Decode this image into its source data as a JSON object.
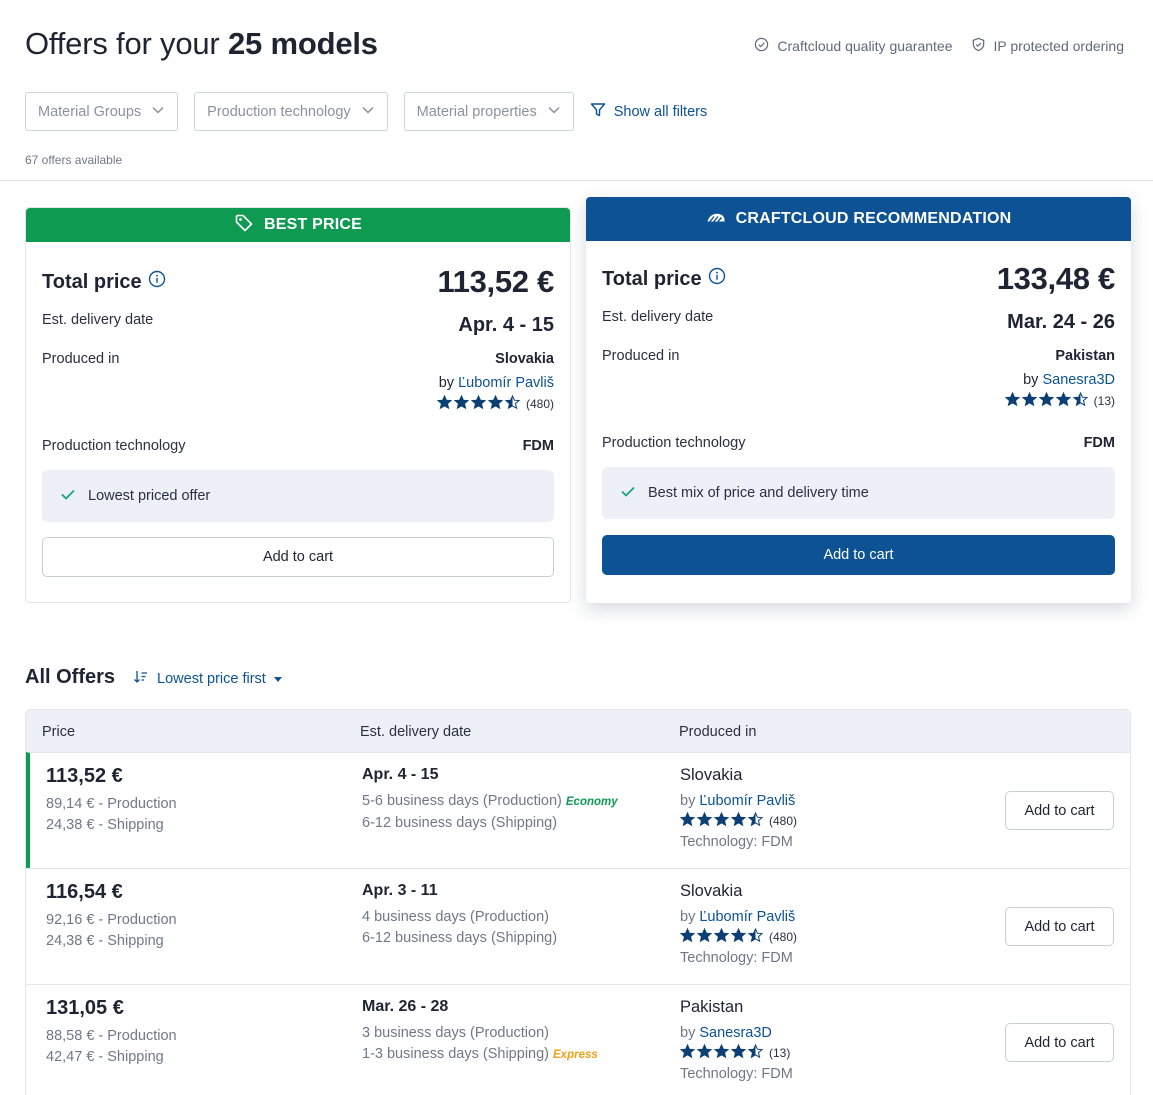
{
  "header": {
    "title_prefix": "Offers for your",
    "title_bold": "25 models",
    "guarantee_quality": "Craftcloud quality guarantee",
    "guarantee_ip": "IP protected ordering"
  },
  "filters": {
    "material_groups": "Material Groups",
    "production_technology": "Production technology",
    "material_properties": "Material properties",
    "show_all": "Show all filters",
    "offers_available": "67 offers available"
  },
  "best_price": {
    "banner": "BEST PRICE",
    "total_label": "Total price",
    "total": "113,52 €",
    "delivery_label": "Est. delivery date",
    "delivery": "Apr. 4 - 15",
    "produced_label": "Produced in",
    "country": "Slovakia",
    "by": "by",
    "vendor": "Ľubomír Pavliš",
    "rating": 4.5,
    "reviews": "(480)",
    "tech_label": "Production technology",
    "tech": "FDM",
    "highlight": "Lowest priced offer",
    "cart": "Add to cart"
  },
  "recommendation": {
    "banner": "CRAFTCLOUD RECOMMENDATION",
    "total_label": "Total price",
    "total": "133,48 €",
    "delivery_label": "Est. delivery date",
    "delivery": "Mar. 24 - 26",
    "produced_label": "Produced in",
    "country": "Pakistan",
    "by": "by",
    "vendor": "Sanesra3D",
    "rating": 4.5,
    "reviews": "(13)",
    "tech_label": "Production technology",
    "tech": "FDM",
    "highlight": "Best mix of price and delivery time",
    "cart": "Add to cart"
  },
  "all_offers": {
    "title": "All Offers",
    "sort": "Lowest price first",
    "columns": [
      "Price",
      "Est. delivery date",
      "Produced in"
    ],
    "rows": [
      {
        "price": "113,52 €",
        "production_cost": "89,14 € - Production",
        "shipping_cost": "24,38 € - Shipping",
        "delivery": "Apr. 4 - 15",
        "production_days": "5-6 business days (Production)",
        "shipping_days": "6-12 business days (Shipping)",
        "badge": "Economy",
        "country": "Slovakia",
        "by": "by",
        "vendor": "Ľubomír Pavliš",
        "rating": 4.5,
        "reviews": "(480)",
        "technology": "Technology: FDM",
        "cart": "Add to cart"
      },
      {
        "price": "116,54 €",
        "production_cost": "92,16 € - Production",
        "shipping_cost": "24,38 € - Shipping",
        "delivery": "Apr. 3 - 11",
        "production_days": "4 business days (Production)",
        "shipping_days": "6-12 business days (Shipping)",
        "badge": "",
        "country": "Slovakia",
        "by": "by",
        "vendor": "Ľubomír Pavliš",
        "rating": 4.5,
        "reviews": "(480)",
        "technology": "Technology: FDM",
        "cart": "Add to cart"
      },
      {
        "price": "131,05 €",
        "production_cost": "88,58 € - Production",
        "shipping_cost": "42,47 € - Shipping",
        "delivery": "Mar. 26 - 28",
        "production_days": "3 business days (Production)",
        "shipping_days": "1-3 business days (Shipping)",
        "badge": "Express",
        "country": "Pakistan",
        "by": "by",
        "vendor": "Sanesra3D",
        "rating": 4.5,
        "reviews": "(13)",
        "technology": "Technology: FDM",
        "cart": "Add to cart"
      }
    ]
  },
  "colors": {
    "accent_blue": "#0c5294",
    "best_green": "#0f9a52",
    "express_orange": "#f0a01a"
  }
}
